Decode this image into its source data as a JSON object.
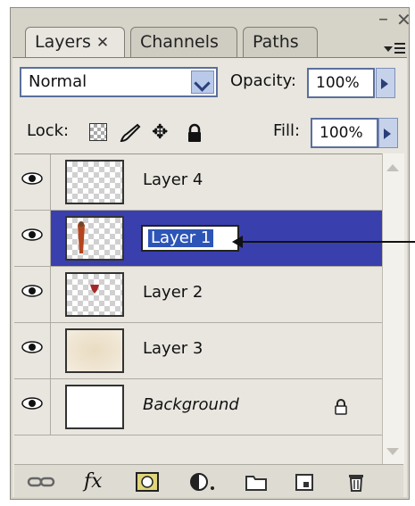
{
  "window": {
    "minimize_glyph": "–",
    "close_glyph": "✕",
    "menu_icon": "panel-menu-icon"
  },
  "tabs": [
    {
      "label": "Layers",
      "close": "✕",
      "active": true
    },
    {
      "label": "Channels",
      "active": false
    },
    {
      "label": "Paths",
      "active": false
    }
  ],
  "blend": {
    "mode": "Normal"
  },
  "opacity": {
    "label": "Opacity:",
    "value": "100%"
  },
  "lock": {
    "label": "Lock:",
    "icons": [
      "lock-transparent-icon",
      "lock-pixels-icon",
      "lock-position-icon",
      "lock-all-icon"
    ]
  },
  "fill": {
    "label": "Fill:",
    "value": "100%"
  },
  "layers": [
    {
      "name": "Layer 4",
      "visible": true,
      "thumb": "checker"
    },
    {
      "name": "Layer 1",
      "visible": true,
      "thumb": "checker",
      "selected": true,
      "editing": true
    },
    {
      "name": "Layer 2",
      "visible": true,
      "thumb": "checker"
    },
    {
      "name": "Layer 3",
      "visible": true,
      "thumb": "beige"
    },
    {
      "name": "Background",
      "visible": true,
      "thumb": "white",
      "locked": true,
      "italic": true
    }
  ],
  "toolbar": {
    "icons": [
      "link-layers-icon",
      "layer-style-icon",
      "layer-mask-icon",
      "adjustment-layer-icon",
      "new-group-icon",
      "new-layer-icon",
      "delete-layer-icon"
    ],
    "fx_label": "fx"
  },
  "colors": {
    "selection": "#3a3fae",
    "panel": "#d6d3c9",
    "field_border": "#5b6f9e"
  }
}
